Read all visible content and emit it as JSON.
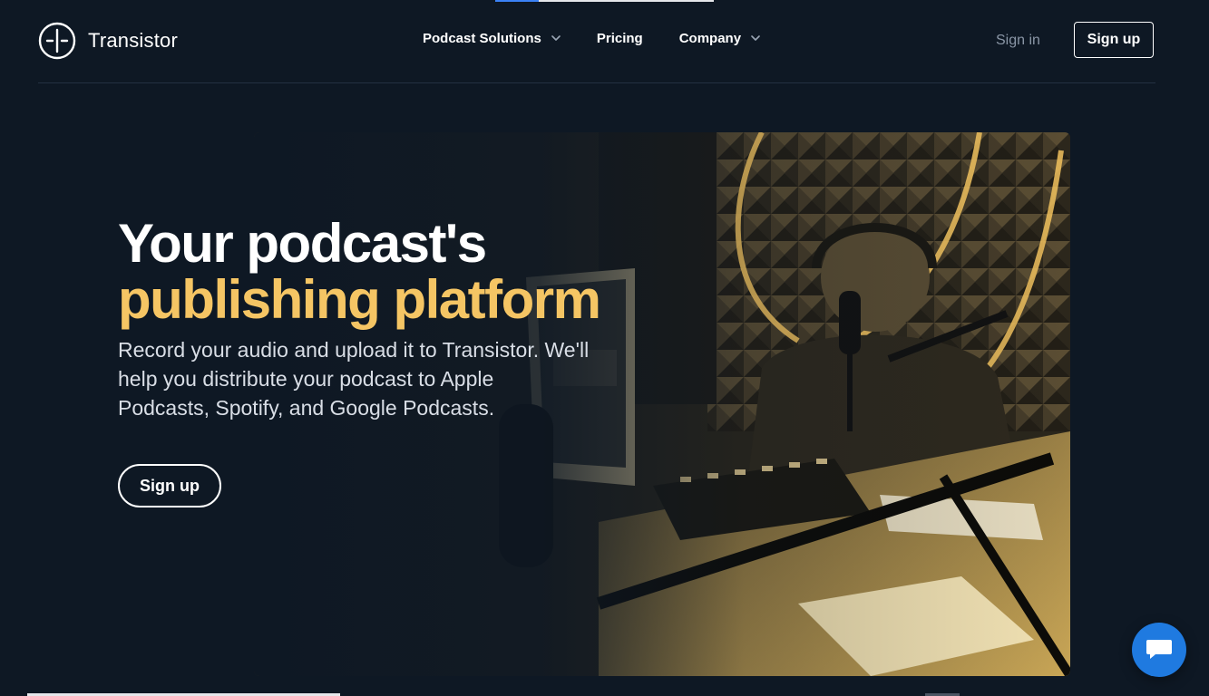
{
  "brand": {
    "name": "Transistor",
    "logo_icon": "transistor-logo-icon"
  },
  "nav": {
    "items": [
      {
        "label": "Podcast Solutions",
        "has_dropdown": true
      },
      {
        "label": "Pricing",
        "has_dropdown": false
      },
      {
        "label": "Company",
        "has_dropdown": true
      }
    ],
    "sign_in": "Sign in",
    "sign_up": "Sign up"
  },
  "hero": {
    "title_line1": "Your podcast's",
    "title_line2": "publishing platform",
    "subtitle": "Record your audio and upload it to Transistor. We'll help you distribute your podcast to Apple Podcasts, Spotify, and Google Podcasts.",
    "cta": "Sign up"
  },
  "chat": {
    "icon": "chat-bubble-icon"
  },
  "colors": {
    "background": "#0e1824",
    "accent": "#f5c564",
    "chat": "#1f7ae0",
    "muted": "#8a96a6"
  }
}
